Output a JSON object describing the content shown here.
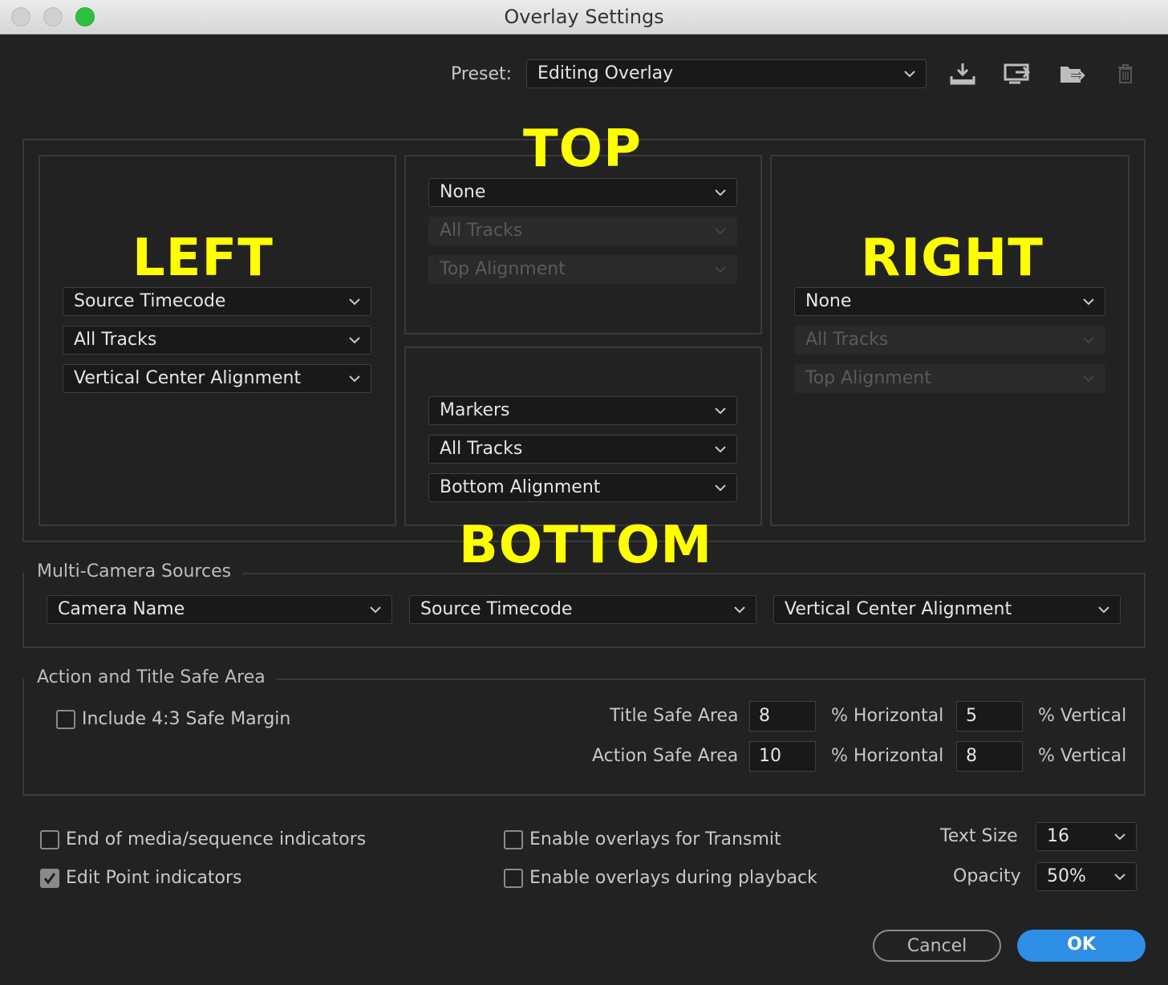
{
  "window": {
    "title": "Overlay Settings"
  },
  "preset": {
    "label": "Preset:",
    "value": "Editing Overlay",
    "icons": [
      "import-preset-icon",
      "export-preset-icon",
      "move-preset-icon",
      "delete-preset-icon"
    ]
  },
  "annotations": {
    "top": "TOP",
    "left": "LEFT",
    "right": "RIGHT",
    "bottom": "BOTTOM",
    "color": "#ffff00"
  },
  "left": {
    "content": "Source Timecode",
    "tracks": "All Tracks",
    "alignment": "Vertical Center Alignment"
  },
  "top": {
    "content": "None",
    "tracks": "All Tracks",
    "alignment": "Top Alignment",
    "tracks_disabled": true
  },
  "right": {
    "content": "None",
    "tracks": "All Tracks",
    "alignment": "Top Alignment",
    "tracks_disabled": true
  },
  "bottom": {
    "content": "Markers",
    "tracks": "All Tracks",
    "alignment": "Bottom Alignment"
  },
  "multicam": {
    "legend": "Multi-Camera Sources",
    "name": "Camera Name",
    "timecode": "Source Timecode",
    "alignment": "Vertical Center Alignment"
  },
  "safe_area": {
    "legend": "Action and Title Safe Area",
    "include_43": {
      "label": "Include 4:3 Safe Margin",
      "checked": false
    },
    "title_label": "Title Safe Area",
    "title_h": "8",
    "title_v": "5",
    "action_label": "Action Safe Area",
    "action_h": "10",
    "action_v": "8",
    "h_unit": "% Horizontal",
    "v_unit": "% Vertical"
  },
  "options": {
    "end_media": {
      "label": "End of media/sequence indicators",
      "checked": false
    },
    "edit_point": {
      "label": "Edit Point indicators",
      "checked": true
    },
    "transmit": {
      "label": "Enable overlays for Transmit",
      "checked": false
    },
    "playback": {
      "label": "Enable overlays during playback",
      "checked": false
    }
  },
  "text_size": {
    "label": "Text Size",
    "value": "16"
  },
  "opacity": {
    "label": "Opacity",
    "value": "50%"
  },
  "buttons": {
    "cancel": "Cancel",
    "ok": "OK"
  },
  "colors": {
    "accent": "#2f8ee6",
    "background": "#222222",
    "annotation": "#ffff00"
  }
}
